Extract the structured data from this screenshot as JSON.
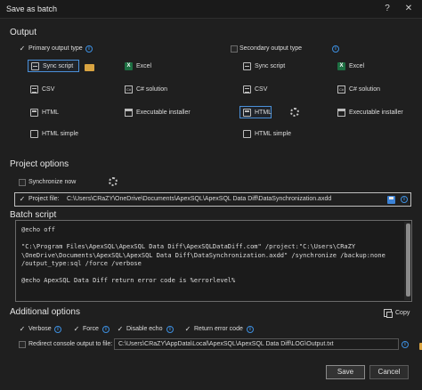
{
  "window": {
    "title": "Save as batch",
    "help": "?",
    "close": "✕"
  },
  "output": {
    "header": "Output",
    "primary": {
      "label": "Primary output type",
      "check": "✓",
      "items": {
        "sync": "Sync script",
        "excel": "Excel",
        "csv": "CSV",
        "csharp": "C# solution",
        "html": "HTML",
        "exe": "Executable installer",
        "htmlsimple": "HTML simple"
      }
    },
    "secondary": {
      "label": "Secondary output type",
      "items": {
        "sync": "Sync script",
        "excel": "Excel",
        "csv": "CSV",
        "csharp": "C# solution",
        "html": "HTML",
        "exe": "Executable installer",
        "htmlsimple": "HTML simple"
      }
    }
  },
  "project": {
    "header": "Project options",
    "sync_now": "Synchronize now",
    "project_file_label": "Project file:",
    "project_file_value": "C:\\Users\\CRaZY\\OneDrive\\Documents\\ApexSQL\\ApexSQL Data Diff\\DataSynchronization.axdd"
  },
  "batch": {
    "header": "Batch script",
    "script": "@echo off\n\n\"C:\\Program Files\\ApexSQL\\ApexSQL Data Diff\\ApexSQLDataDiff.com\" /project:\"C:\\Users\\CRaZY\n\\OneDrive\\Documents\\ApexSQL\\ApexSQL Data Diff\\DataSynchronization.axdd\" /synchronize /backup:none\n/output_type:sql /force /verbose\n\n@echo ApexSQL Data Diff return error code is %errorlevel%"
  },
  "additional": {
    "header": "Additional options",
    "copy": "Copy",
    "verbose": "Verbose",
    "force": "Force",
    "disable_echo": "Disable echo",
    "return_error": "Return error code",
    "redirect_label": "Redirect console output to file:",
    "redirect_value": "C:\\Users\\CRaZY\\AppData\\Local\\ApexSQL\\ApexSQL Data Diff\\LOG\\Output.txt"
  },
  "buttons": {
    "save": "Save",
    "cancel": "Cancel"
  },
  "icons": {
    "info": "i",
    "excel_letter": "X",
    "csharp_letter": "C#"
  },
  "colors": {
    "accent": "#3d8fe0",
    "background": "#1f1f1f",
    "excel": "#1d6f42",
    "folder": "#d9a441"
  }
}
